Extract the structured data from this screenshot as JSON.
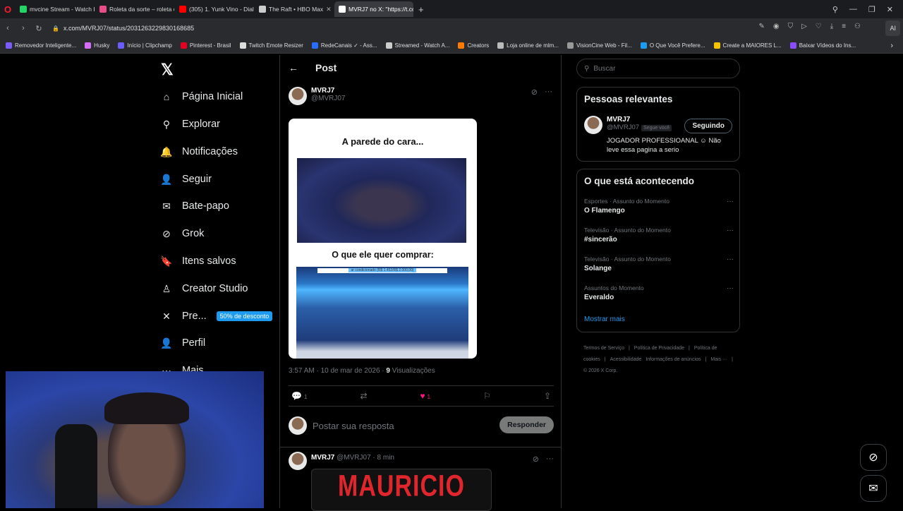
{
  "browser": {
    "tabs": [
      {
        "title": "mvcine Stream - Watch Li",
        "color": "#25d366",
        "active": false
      },
      {
        "title": "Roleta da sorte – roleta o",
        "color": "#e84d8a",
        "active": false
      },
      {
        "title": "(305) 1. Yunk Vino - Dialo",
        "color": "#ff0000",
        "active": false
      },
      {
        "title": "The Raft • HBO Max",
        "color": "#cccccc",
        "active": false
      },
      {
        "title": "MVRJ7 no X: \"https://t.co",
        "color": "#ffffff",
        "active": true
      }
    ],
    "url": "x.com/MVRJ07/status/2031263229830168685",
    "ai_label": "AI",
    "bookmarks": [
      {
        "label": "Removedor Inteligente...",
        "color": "#7b5cff"
      },
      {
        "label": "Husky",
        "color": "#d46cff"
      },
      {
        "label": "Início | Clipchamp",
        "color": "#6a5cff"
      },
      {
        "label": "Pinterest - Brasil",
        "color": "#e60023"
      },
      {
        "label": "Twitch Emote Resizer",
        "color": "#dddddd"
      },
      {
        "label": "RedeCanais ✓ - Ass...",
        "color": "#2a6cff"
      },
      {
        "label": "Streamed - Watch A...",
        "color": "#cccccc"
      },
      {
        "label": "Creators",
        "color": "#ff7a00"
      },
      {
        "label": "Loja online de mlm...",
        "color": "#bbbbbb"
      },
      {
        "label": "VisionCine Web - Fil...",
        "color": "#999999"
      },
      {
        "label": "O Que Você Prefere...",
        "color": "#1d9bf0"
      },
      {
        "label": "Create a MAIORES L...",
        "color": "#f5c400"
      },
      {
        "label": "Baixar Vídeos do Ins...",
        "color": "#8a4cff"
      }
    ]
  },
  "nav": {
    "items": [
      {
        "label": "Página Inicial",
        "icon": "home-icon",
        "glyph": "⌂"
      },
      {
        "label": "Explorar",
        "icon": "search-icon",
        "glyph": "⚲"
      },
      {
        "label": "Notificações",
        "icon": "bell-icon",
        "glyph": "🔔"
      },
      {
        "label": "Seguir",
        "icon": "add-user-icon",
        "glyph": "👤"
      },
      {
        "label": "Bate-papo",
        "icon": "mail-icon",
        "glyph": "✉"
      },
      {
        "label": "Grok",
        "icon": "grok-icon",
        "glyph": "⊘"
      },
      {
        "label": "Itens salvos",
        "icon": "bookmark-icon",
        "glyph": "🔖"
      },
      {
        "label": "Creator Studio",
        "icon": "creator-studio-icon",
        "glyph": "♙"
      },
      {
        "label": "Pre...",
        "icon": "x-premium-icon",
        "glyph": "✕"
      },
      {
        "label": "Perfil",
        "icon": "profile-icon",
        "glyph": "👤"
      },
      {
        "label": "Mais",
        "icon": "more-icon",
        "glyph": "⋯"
      }
    ],
    "promo_badge": "50% de desconto"
  },
  "post": {
    "header_title": "Post",
    "author_name": "MVRJ7",
    "author_handle": "@MVRJ07",
    "meme_title": "A parede do cara...",
    "meme_subtitle": "O que ele quer comprar:",
    "meme_price": "ar condicionado (R$ 1.452/R$ 2.000,00)",
    "timestamp": "3:57 AM · 10 de mar de 2026 · ",
    "views_count": "9",
    "views_label": " Visualizações",
    "reply_count": "1",
    "like_count": "1",
    "reply_placeholder": "Postar sua resposta",
    "reply_button": "Responder"
  },
  "next_tweet": {
    "author_name": "MVRJ7",
    "handle_time": "@MVRJ07 · 8 min",
    "banner_text": "MAURICIO"
  },
  "sidebar": {
    "search_placeholder": "Buscar",
    "relevant_title": "Pessoas relevantes",
    "relevant_user": {
      "name": "MVRJ7",
      "handle": "@MVRJ07",
      "follows_you": "Segue você",
      "follow_button": "Seguindo",
      "bio": "JOGADOR PROFESSIOANAL ☺ Não leve essa pagina a serio"
    },
    "trends_title": "O que está acontecendo",
    "trends": [
      {
        "category": "Esportes · Assunto do Momento",
        "topic": "O Flamengo"
      },
      {
        "category": "Televisão · Assunto do Momento",
        "topic": "#sincerão"
      },
      {
        "category": "Televisão · Assunto do Momento",
        "topic": "Solange"
      },
      {
        "category": "Assuntos do Momento",
        "topic": "Everaldo"
      }
    ],
    "show_more": "Mostrar mais",
    "footer_links": [
      "Termos de Serviço",
      "|",
      "Política de Privacidade",
      "|",
      "Política de cookies",
      "|",
      "Acessibilidade",
      "Informações de anúncios",
      "|",
      "Mais ···",
      "|",
      "© 2026 X Corp."
    ]
  }
}
